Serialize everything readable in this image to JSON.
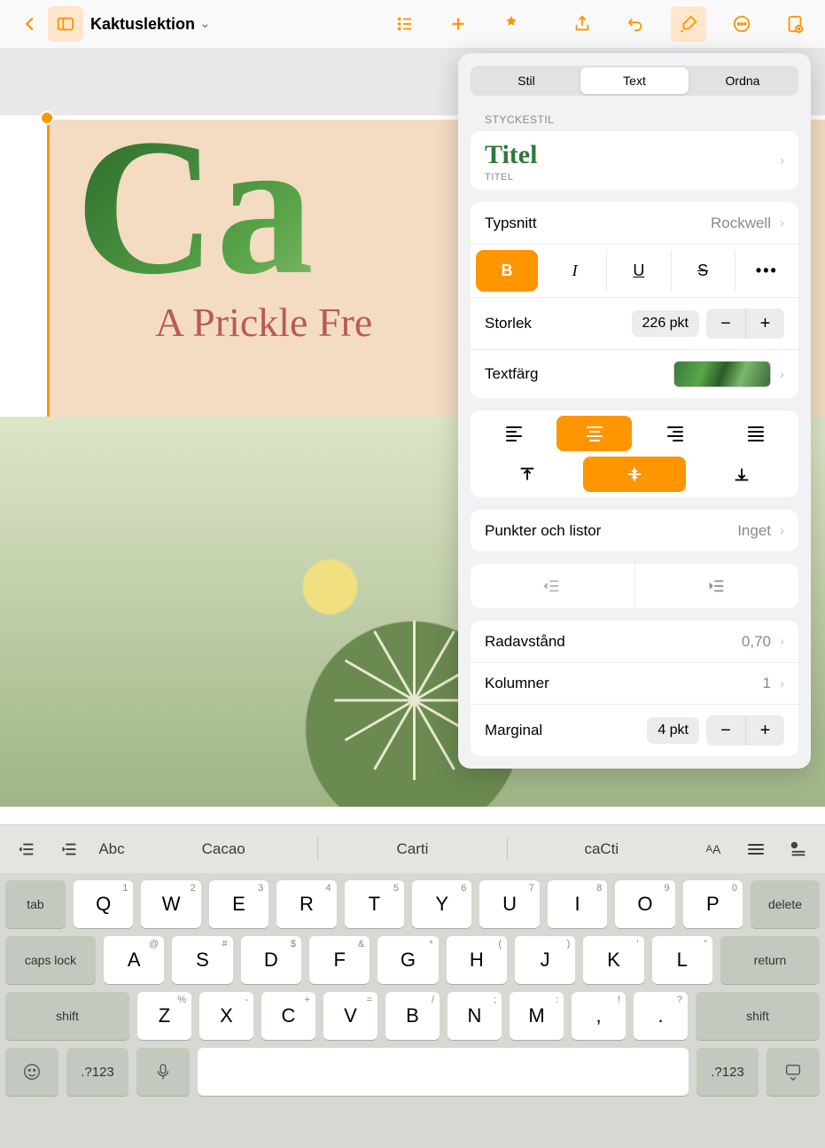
{
  "toolbar": {
    "doc_title": "Kaktuslektion"
  },
  "slide": {
    "title": "Ca",
    "subtitle": "A Prickle Fre"
  },
  "panel": {
    "tabs": {
      "style": "Stil",
      "text": "Text",
      "arrange": "Ordna"
    },
    "paragraph_style_label": "STYCKESTIL",
    "title_style": "Titel",
    "title_style_sub": "TITEL",
    "font_label": "Typsnitt",
    "font_value": "Rockwell",
    "size_label": "Storlek",
    "size_value": "226 pkt",
    "color_label": "Textfärg",
    "bullets_label": "Punkter och listor",
    "bullets_value": "Inget",
    "line_spacing_label": "Radavstånd",
    "line_spacing_value": "0,70",
    "columns_label": "Kolumner",
    "columns_value": "1",
    "margin_label": "Marginal",
    "margin_value": "4 pkt",
    "style_btns": {
      "bold": "B",
      "italic": "I",
      "underline": "U",
      "strike": "S",
      "more": "•••"
    },
    "stepper": {
      "minus": "−",
      "plus": "+"
    }
  },
  "shortcut": {
    "abc": "Abc",
    "sug1": "Cacao",
    "sug2": "Carti",
    "sug3": "caCti",
    "aa": "AA"
  },
  "keyboard": {
    "row0": [
      {
        "m": "Q",
        "h": "1"
      },
      {
        "m": "W",
        "h": "2"
      },
      {
        "m": "E",
        "h": "3"
      },
      {
        "m": "R",
        "h": "4"
      },
      {
        "m": "T",
        "h": "5"
      },
      {
        "m": "Y",
        "h": "6"
      },
      {
        "m": "U",
        "h": "7"
      },
      {
        "m": "I",
        "h": "8"
      },
      {
        "m": "O",
        "h": "9"
      },
      {
        "m": "P",
        "h": "0"
      }
    ],
    "row1": [
      {
        "m": "A",
        "h": "@"
      },
      {
        "m": "S",
        "h": "#"
      },
      {
        "m": "D",
        "h": "$"
      },
      {
        "m": "F",
        "h": "&"
      },
      {
        "m": "G",
        "h": "*"
      },
      {
        "m": "H",
        "h": "("
      },
      {
        "m": "J",
        "h": ")"
      },
      {
        "m": "K",
        "h": "'"
      },
      {
        "m": "L",
        "h": "\""
      }
    ],
    "row2": [
      {
        "m": "Z",
        "h": "%"
      },
      {
        "m": "X",
        "h": "-"
      },
      {
        "m": "C",
        "h": "+"
      },
      {
        "m": "V",
        "h": "="
      },
      {
        "m": "B",
        "h": "/"
      },
      {
        "m": "N",
        "h": ";"
      },
      {
        "m": "M",
        "h": ":"
      },
      {
        "m": ",",
        "h": "!"
      },
      {
        "m": ".",
        "h": "?"
      }
    ],
    "func": {
      "tab": "tab",
      "delete": "delete",
      "caps": "caps lock",
      "return": "return",
      "shift": "shift",
      "num": ".?123",
      "emoji": "☺",
      "mic": "🎤",
      "dismiss": "⌨"
    }
  }
}
